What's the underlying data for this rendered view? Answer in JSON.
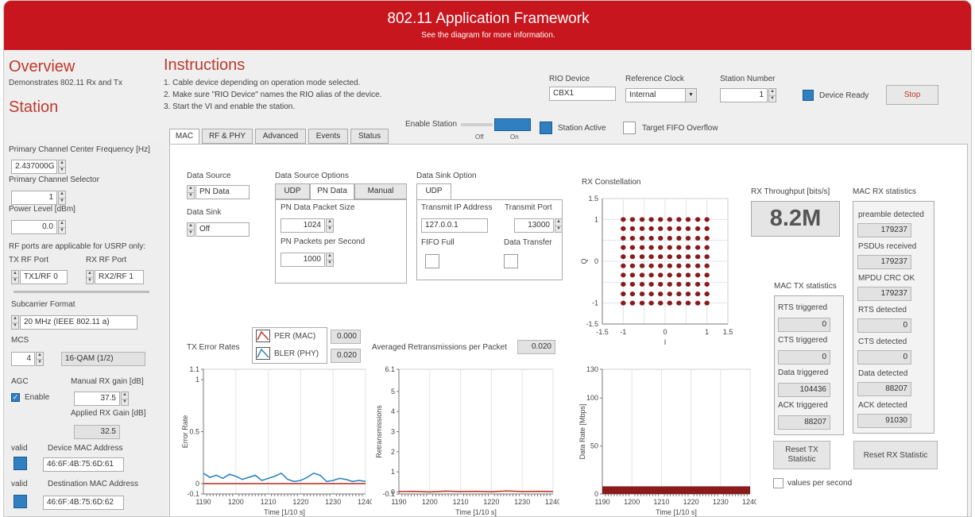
{
  "header": {
    "title": "802.11 Application Framework",
    "subtitle": "See the diagram for more information."
  },
  "overview": {
    "title": "Overview",
    "desc": "Demonstrates 802.11 Rx and Tx",
    "station": "Station"
  },
  "instructions": {
    "title": "Instructions",
    "lines": [
      "1. Cable device depending on operation mode selected.",
      "2. Make sure \"RIO Device\" names the RIO alias of the device.",
      "3. Start the VI and enable the station."
    ]
  },
  "top": {
    "rio_label": "RIO Device",
    "rio_value": "CBX1",
    "refclk_label": "Reference Clock",
    "refclk_value": "Internal",
    "station_num_label": "Station Number",
    "station_num_value": "1",
    "device_ready": "Device Ready",
    "stop": "Stop",
    "enable_station": "Enable Station",
    "off": "Off",
    "on": "On",
    "station_active": "Station Active",
    "fifo_overflow": "Target FIFO Overflow"
  },
  "tabs": [
    "MAC",
    "RF & PHY",
    "Advanced",
    "Events",
    "Status"
  ],
  "sidebar": {
    "freq_label": "Primary Channel Center Frequency [Hz]",
    "freq_value": "2.437000G",
    "chan_label": "Primary Channel Selector",
    "chan_value": "1",
    "power_label": "Power Level [dBm]",
    "power_value": "0.0",
    "rf_note": "RF ports are applicable for USRP only:",
    "tx_port_label": "TX RF Port",
    "tx_port_value": "TX1/RF 0",
    "rx_port_label": "RX RF Port",
    "rx_port_value": "RX2/RF 1",
    "subcarrier_label": "Subcarrier Format",
    "subcarrier_value": "20 MHz (IEEE 802.11 a)",
    "mcs_label": "MCS",
    "mcs_value": "4",
    "mcs_desc": "16-QAM (1/2)",
    "agc_label": "AGC",
    "agc_enable": "Enable",
    "manual_gain_label": "Manual RX gain [dB]",
    "manual_gain_value": "37.5",
    "applied_gain_label": "Applied RX Gain [dB]",
    "applied_gain_value": "32.5",
    "valid1": "valid",
    "dev_mac_label": "Device MAC Address",
    "dev_mac_value": "46:6F:4B:75:6D:61",
    "valid2": "valid",
    "dst_mac_label": "Destination MAC Address",
    "dst_mac_value": "46:6F:4B:75:6D:62"
  },
  "mac": {
    "data_source_label": "Data Source",
    "data_source_value": "PN Data",
    "data_sink_label": "Data Sink",
    "data_sink_value": "Off",
    "dso_label": "Data Source Options",
    "dso_tabs": [
      "UDP",
      "PN Data",
      "Manual"
    ],
    "pn_size_label": "PN Data Packet Size",
    "pn_size_value": "1024",
    "pn_pps_label": "PN Packets per Second",
    "pn_pps_value": "1000",
    "sink_option_label": "Data Sink Option",
    "sink_tab": "UDP",
    "tx_ip_label": "Transmit IP Address",
    "tx_ip_value": "127.0.0.1",
    "tx_port_label": "Transmit Port",
    "tx_port_value": "13000",
    "fifo_full": "FIFO Full",
    "data_transfer": "Data Transfer",
    "rx_const_label": "RX Constellation",
    "throughput_label": "RX Throughput [bits/s]",
    "throughput_value": "8.2M",
    "rx_stats_title": "MAC RX statistics",
    "rx_stats": [
      {
        "label": "preamble detected",
        "value": "179237"
      },
      {
        "label": "PSDUs received",
        "value": "179237"
      },
      {
        "label": "MPDU CRC OK",
        "value": "179237"
      },
      {
        "label": "RTS detected",
        "value": "0"
      },
      {
        "label": "CTS detected",
        "value": "0"
      },
      {
        "label": "Data detected",
        "value": "88207"
      },
      {
        "label": "ACK detected",
        "value": "91030"
      }
    ],
    "tx_stats_title": "MAC TX statistics",
    "tx_stats": [
      {
        "label": "RTS triggered",
        "value": "0"
      },
      {
        "label": "CTS triggered",
        "value": "0"
      },
      {
        "label": "Data triggered",
        "value": "104436"
      },
      {
        "label": "ACK triggered",
        "value": "88207"
      }
    ],
    "reset_tx": "Reset TX Statistic",
    "reset_rx": "Reset RX Statistic",
    "values_per_second": "values per second",
    "tx_error_label": "TX Error Rates",
    "per_label": "PER (MAC)",
    "per_value": "0.000",
    "bler_label": "BLER (PHY)",
    "bler_value": "0.020",
    "avg_retx_label": "Averaged Retransmissions per Packet",
    "avg_retx_value": "0.020"
  },
  "chart_data": [
    {
      "type": "line",
      "ylabel": "Error Rate",
      "xlabel": "Time [1/10 s]",
      "xlim": [
        1190,
        1240
      ],
      "ylim": [
        -0.1,
        1.1
      ],
      "yticks": [
        "1.1",
        "1",
        "0.5",
        "0",
        "-0.1"
      ],
      "xticks": [
        "1190",
        "1200",
        "1210",
        "1220",
        "1230",
        "1240"
      ],
      "series": [
        {
          "name": "PER (MAC)",
          "color": "#c0392b",
          "x": [
            1190,
            1240
          ],
          "y": [
            0,
            0
          ]
        },
        {
          "name": "BLER (PHY)",
          "color": "#2e86c1",
          "x": [
            1190,
            1192,
            1194,
            1196,
            1198,
            1200,
            1202,
            1204,
            1206,
            1208,
            1210,
            1212,
            1214,
            1216,
            1218,
            1220,
            1222,
            1224,
            1226,
            1228,
            1230,
            1232,
            1234,
            1236,
            1238,
            1240
          ],
          "y": [
            0.1,
            0.06,
            0.08,
            0.05,
            0.09,
            0.07,
            0.04,
            0.06,
            0.08,
            0.03,
            0.05,
            0.07,
            0.1,
            0.04,
            0.02,
            0.03,
            0.06,
            0.1,
            0.08,
            0.02,
            0.03,
            0.05,
            0.04,
            0.02,
            0.03,
            0.02
          ]
        }
      ]
    },
    {
      "type": "line",
      "ylabel": "Retransmissions",
      "xlabel": "Time [1/10 s]",
      "xlim": [
        1190,
        1240
      ],
      "ylim": [
        -0.1,
        6.1
      ],
      "yticks": [
        "6.1",
        "5",
        "4",
        "3",
        "2",
        "1",
        "0",
        "-0.1"
      ],
      "xticks": [
        "1190",
        "1200",
        "1210",
        "1220",
        "1230",
        "1240"
      ],
      "series": [
        {
          "color": "#c0392b",
          "x": [
            1190,
            1195,
            1200,
            1205,
            1210,
            1215,
            1220,
            1225,
            1230,
            1235,
            1240
          ],
          "y": [
            0.02,
            0.03,
            0.0,
            0.04,
            0.02,
            0.03,
            0.01,
            0.05,
            0.02,
            0.03,
            0.02
          ]
        }
      ]
    },
    {
      "type": "area",
      "ylabel": "Data Rate [Mbps]",
      "xlabel": "Time [1/10 s]",
      "xlim": [
        1190,
        1240
      ],
      "ylim": [
        0,
        130
      ],
      "yticks": [
        "130",
        "100",
        "50",
        "0"
      ],
      "xticks": [
        "1190",
        "1200",
        "1210",
        "1220",
        "1230",
        "1240"
      ],
      "series": [
        {
          "color": "#8b1a1a",
          "x": [
            1190,
            1240
          ],
          "y": [
            8,
            8
          ]
        }
      ]
    },
    {
      "type": "scatter",
      "ylabel": "Q",
      "xlabel": "I",
      "xlim": [
        -1.5,
        1.5
      ],
      "ylim": [
        -1.5,
        1.5
      ],
      "yticks": [
        "1.5",
        "1",
        "0",
        "-1",
        "-1.5"
      ],
      "xticks": [
        "-1.5",
        "-1",
        "0",
        "1",
        "1.5"
      ],
      "series": [
        {
          "color": "#8b1a1a",
          "levels": [
            -1,
            -0.78,
            -0.55,
            -0.33,
            -0.11,
            0.11,
            0.33,
            0.55,
            0.78,
            1
          ]
        }
      ]
    }
  ]
}
